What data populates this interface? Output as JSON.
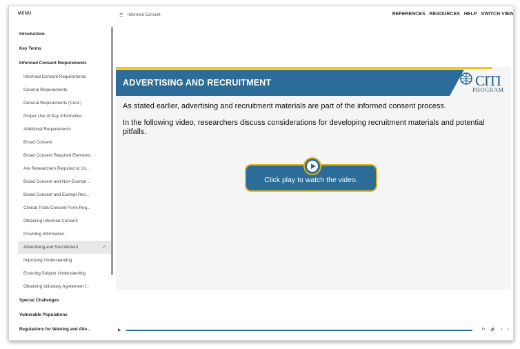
{
  "menu": {
    "title": "MENU",
    "items": [
      {
        "label": "Introduction",
        "type": "section"
      },
      {
        "label": "Key Terms",
        "type": "section"
      },
      {
        "label": "Informed Consent Requirements",
        "type": "section"
      },
      {
        "label": "Informed Consent Requirements",
        "type": "sub"
      },
      {
        "label": "General Requirements",
        "type": "sub"
      },
      {
        "label": "General Requirements (Cont.)",
        "type": "sub"
      },
      {
        "label": "Proper Use of Key Information",
        "type": "sub"
      },
      {
        "label": "Additional Requirements",
        "type": "sub"
      },
      {
        "label": "Broad Consent",
        "type": "sub"
      },
      {
        "label": "Broad Consent Required Elements",
        "type": "sub"
      },
      {
        "label": "Are Researchers Required to Us...",
        "type": "sub"
      },
      {
        "label": "Broad Consent and Non-Exempt ...",
        "type": "sub"
      },
      {
        "label": "Broad Consent and Exempt Res...",
        "type": "sub"
      },
      {
        "label": "Clinical Trials Consent Form Req...",
        "type": "sub"
      },
      {
        "label": "Obtaining Informed Consent",
        "type": "sub"
      },
      {
        "label": "Providing Information",
        "type": "sub"
      },
      {
        "label": "Advertising and Recruitment",
        "type": "sub",
        "active": true,
        "check": "✓"
      },
      {
        "label": "Improving Understanding",
        "type": "sub"
      },
      {
        "label": "Ensuring Subject Understanding",
        "type": "sub"
      },
      {
        "label": "Obtaining Voluntary Agreement I...",
        "type": "sub"
      },
      {
        "label": "Special Challenges",
        "type": "section"
      },
      {
        "label": "Vulnerable Populations",
        "type": "section"
      },
      {
        "label": "Regulations for Waiving and Alte...",
        "type": "section"
      }
    ]
  },
  "topbar": {
    "hamburger_icon": "☰",
    "breadcrumb": "Informed Consent",
    "nav": [
      "REFERENCES",
      "RESOURCES",
      "HELP",
      "SWITCH VIEW"
    ]
  },
  "slide": {
    "title": "ADVERTISING AND RECRUITMENT",
    "logo_main": "CITI",
    "logo_sub": "PROGRAM",
    "paragraph1": "As stated earlier, advertising and recruitment materials are part of the informed consent process.",
    "paragraph2": "In the following video, researchers discuss considerations for developing recruitment materials and potential pitfalls.",
    "play_label": "Click play to watch the video."
  },
  "player": {
    "play_icon": "▶",
    "icons": "↻ 🔊 ‹ ›"
  },
  "colors": {
    "banner_blue": "#2b6c99",
    "accent_gold": "#e0b21d",
    "content_bg": "#f5f5f5"
  }
}
